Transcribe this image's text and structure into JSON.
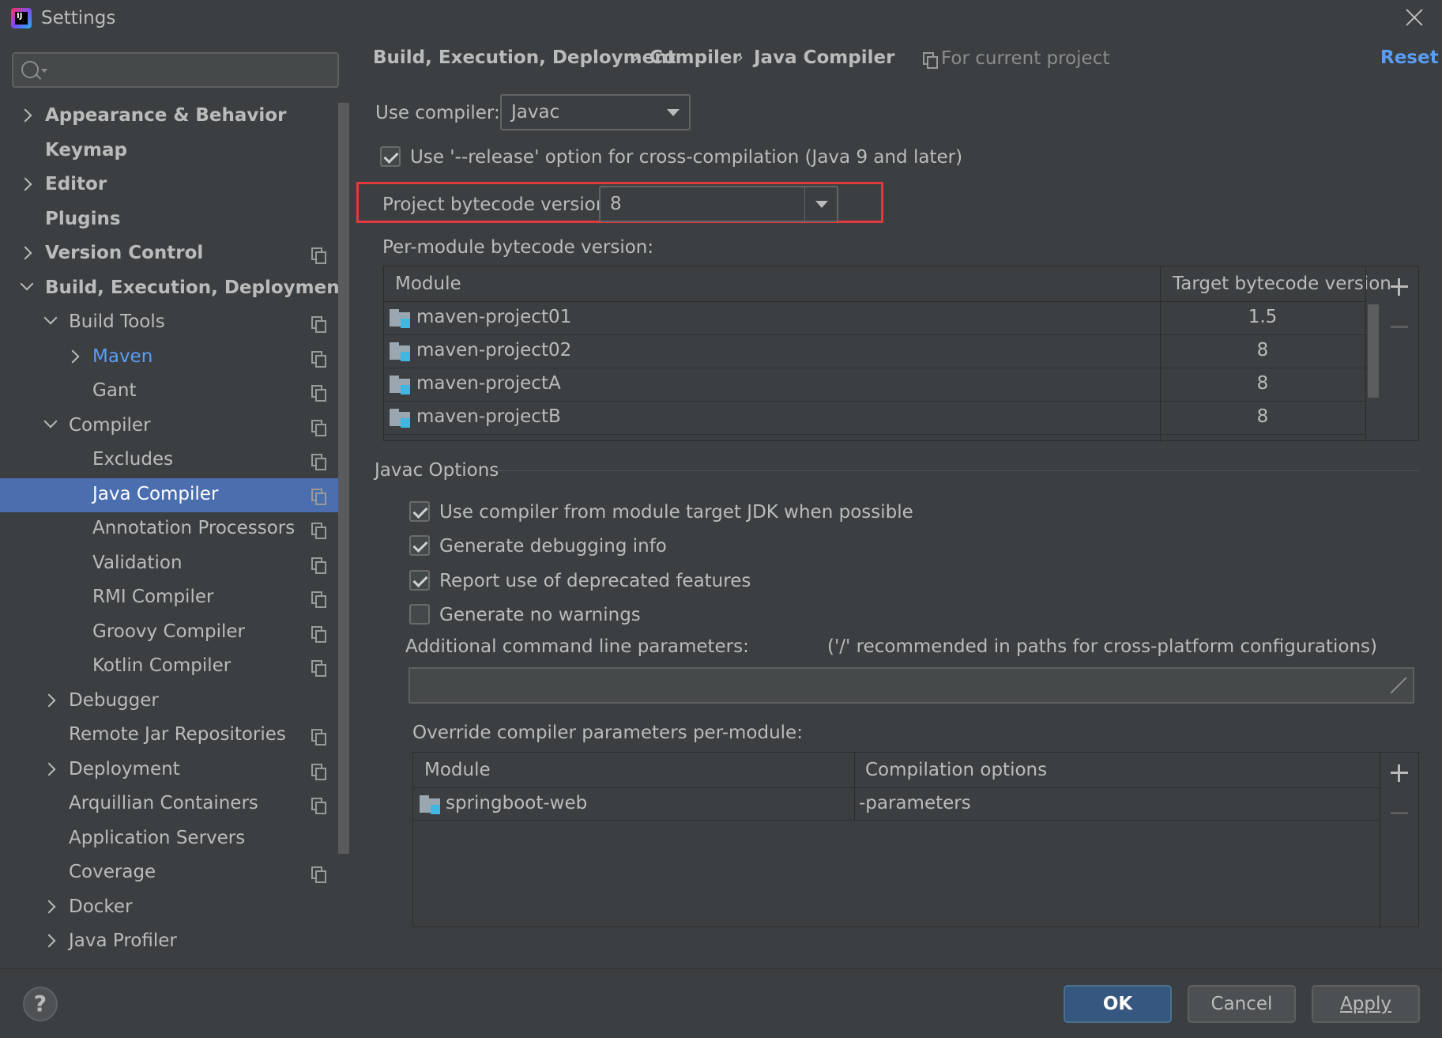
{
  "window": {
    "title": "Settings"
  },
  "search": {
    "placeholder": ""
  },
  "tree": [
    {
      "label": "Appearance & Behavior",
      "bold": true,
      "indent": 0,
      "chevron": "right",
      "copy": false
    },
    {
      "label": "Keymap",
      "bold": true,
      "indent": 0,
      "chevron": "none",
      "copy": false
    },
    {
      "label": "Editor",
      "bold": true,
      "indent": 0,
      "chevron": "right",
      "copy": false
    },
    {
      "label": "Plugins",
      "bold": true,
      "indent": 0,
      "chevron": "none",
      "copy": false
    },
    {
      "label": "Version Control",
      "bold": true,
      "indent": 0,
      "chevron": "right",
      "copy": true
    },
    {
      "label": "Build, Execution, Deployment",
      "bold": true,
      "indent": 0,
      "chevron": "down",
      "copy": false
    },
    {
      "label": "Build Tools",
      "bold": false,
      "indent": 1,
      "chevron": "down",
      "copy": true
    },
    {
      "label": "Maven",
      "bold": false,
      "indent": 2,
      "chevron": "right",
      "copy": true,
      "link": true
    },
    {
      "label": "Gant",
      "bold": false,
      "indent": 2,
      "chevron": "none",
      "copy": true
    },
    {
      "label": "Compiler",
      "bold": false,
      "indent": 1,
      "chevron": "down",
      "copy": true
    },
    {
      "label": "Excludes",
      "bold": false,
      "indent": 2,
      "chevron": "none",
      "copy": true
    },
    {
      "label": "Java Compiler",
      "bold": false,
      "indent": 2,
      "chevron": "none",
      "copy": true,
      "selected": true
    },
    {
      "label": "Annotation Processors",
      "bold": false,
      "indent": 2,
      "chevron": "none",
      "copy": true
    },
    {
      "label": "Validation",
      "bold": false,
      "indent": 2,
      "chevron": "none",
      "copy": true
    },
    {
      "label": "RMI Compiler",
      "bold": false,
      "indent": 2,
      "chevron": "none",
      "copy": true
    },
    {
      "label": "Groovy Compiler",
      "bold": false,
      "indent": 2,
      "chevron": "none",
      "copy": true
    },
    {
      "label": "Kotlin Compiler",
      "bold": false,
      "indent": 2,
      "chevron": "none",
      "copy": true
    },
    {
      "label": "Debugger",
      "bold": false,
      "indent": 1,
      "chevron": "right",
      "copy": false
    },
    {
      "label": "Remote Jar Repositories",
      "bold": false,
      "indent": 1,
      "chevron": "none",
      "copy": true
    },
    {
      "label": "Deployment",
      "bold": false,
      "indent": 1,
      "chevron": "right",
      "copy": true
    },
    {
      "label": "Arquillian Containers",
      "bold": false,
      "indent": 1,
      "chevron": "none",
      "copy": true
    },
    {
      "label": "Application Servers",
      "bold": false,
      "indent": 1,
      "chevron": "none",
      "copy": false
    },
    {
      "label": "Coverage",
      "bold": false,
      "indent": 1,
      "chevron": "none",
      "copy": true
    },
    {
      "label": "Docker",
      "bold": false,
      "indent": 1,
      "chevron": "right",
      "copy": false
    },
    {
      "label": "Java Profiler",
      "bold": false,
      "indent": 1,
      "chevron": "right",
      "copy": false
    }
  ],
  "breadcrumb": {
    "part1": "Build, Execution, Deployment",
    "part2": "Compiler",
    "part3": "Java Compiler",
    "sep": "›"
  },
  "scope": "For current project",
  "reset_label": "Reset",
  "use_compiler": {
    "label": "Use compiler:",
    "value": "Javac"
  },
  "release_option": {
    "label": "Use '--release' option for cross-compilation (Java 9 and later)",
    "checked": true
  },
  "project_bytecode": {
    "label": "Project bytecode version:",
    "value": "8"
  },
  "per_module": {
    "label": "Per-module bytecode version:",
    "col_module": "Module",
    "col_target": "Target bytecode version",
    "rows": [
      {
        "module": "maven-project01",
        "version": "1.5"
      },
      {
        "module": "maven-project02",
        "version": "8"
      },
      {
        "module": "maven-projectA",
        "version": "8"
      },
      {
        "module": "maven-projectB",
        "version": "8"
      }
    ]
  },
  "javac": {
    "title": "Javac Options",
    "options": [
      {
        "label": "Use compiler from module target JDK when possible",
        "checked": true
      },
      {
        "label": "Generate debugging info",
        "checked": true
      },
      {
        "label": "Report use of deprecated features",
        "checked": true
      },
      {
        "label": "Generate no warnings",
        "checked": false
      }
    ],
    "cmdline_label": "Additional command line parameters:",
    "cmdline_hint": "('/' recommended in paths for cross-platform configurations)",
    "cmdline_value": "",
    "override_label": "Override compiler parameters per-module:",
    "override_col_module": "Module",
    "override_col_options": "Compilation options",
    "override_rows": [
      {
        "module": "springboot-web",
        "options": "-parameters"
      }
    ]
  },
  "buttons": {
    "help": "?",
    "ok": "OK",
    "cancel": "Cancel",
    "apply": "Apply"
  },
  "colors": {
    "selection": "#4b6eaf",
    "link": "#589df6",
    "highlight_box": "#e0393e",
    "ok_button": "#365880"
  }
}
